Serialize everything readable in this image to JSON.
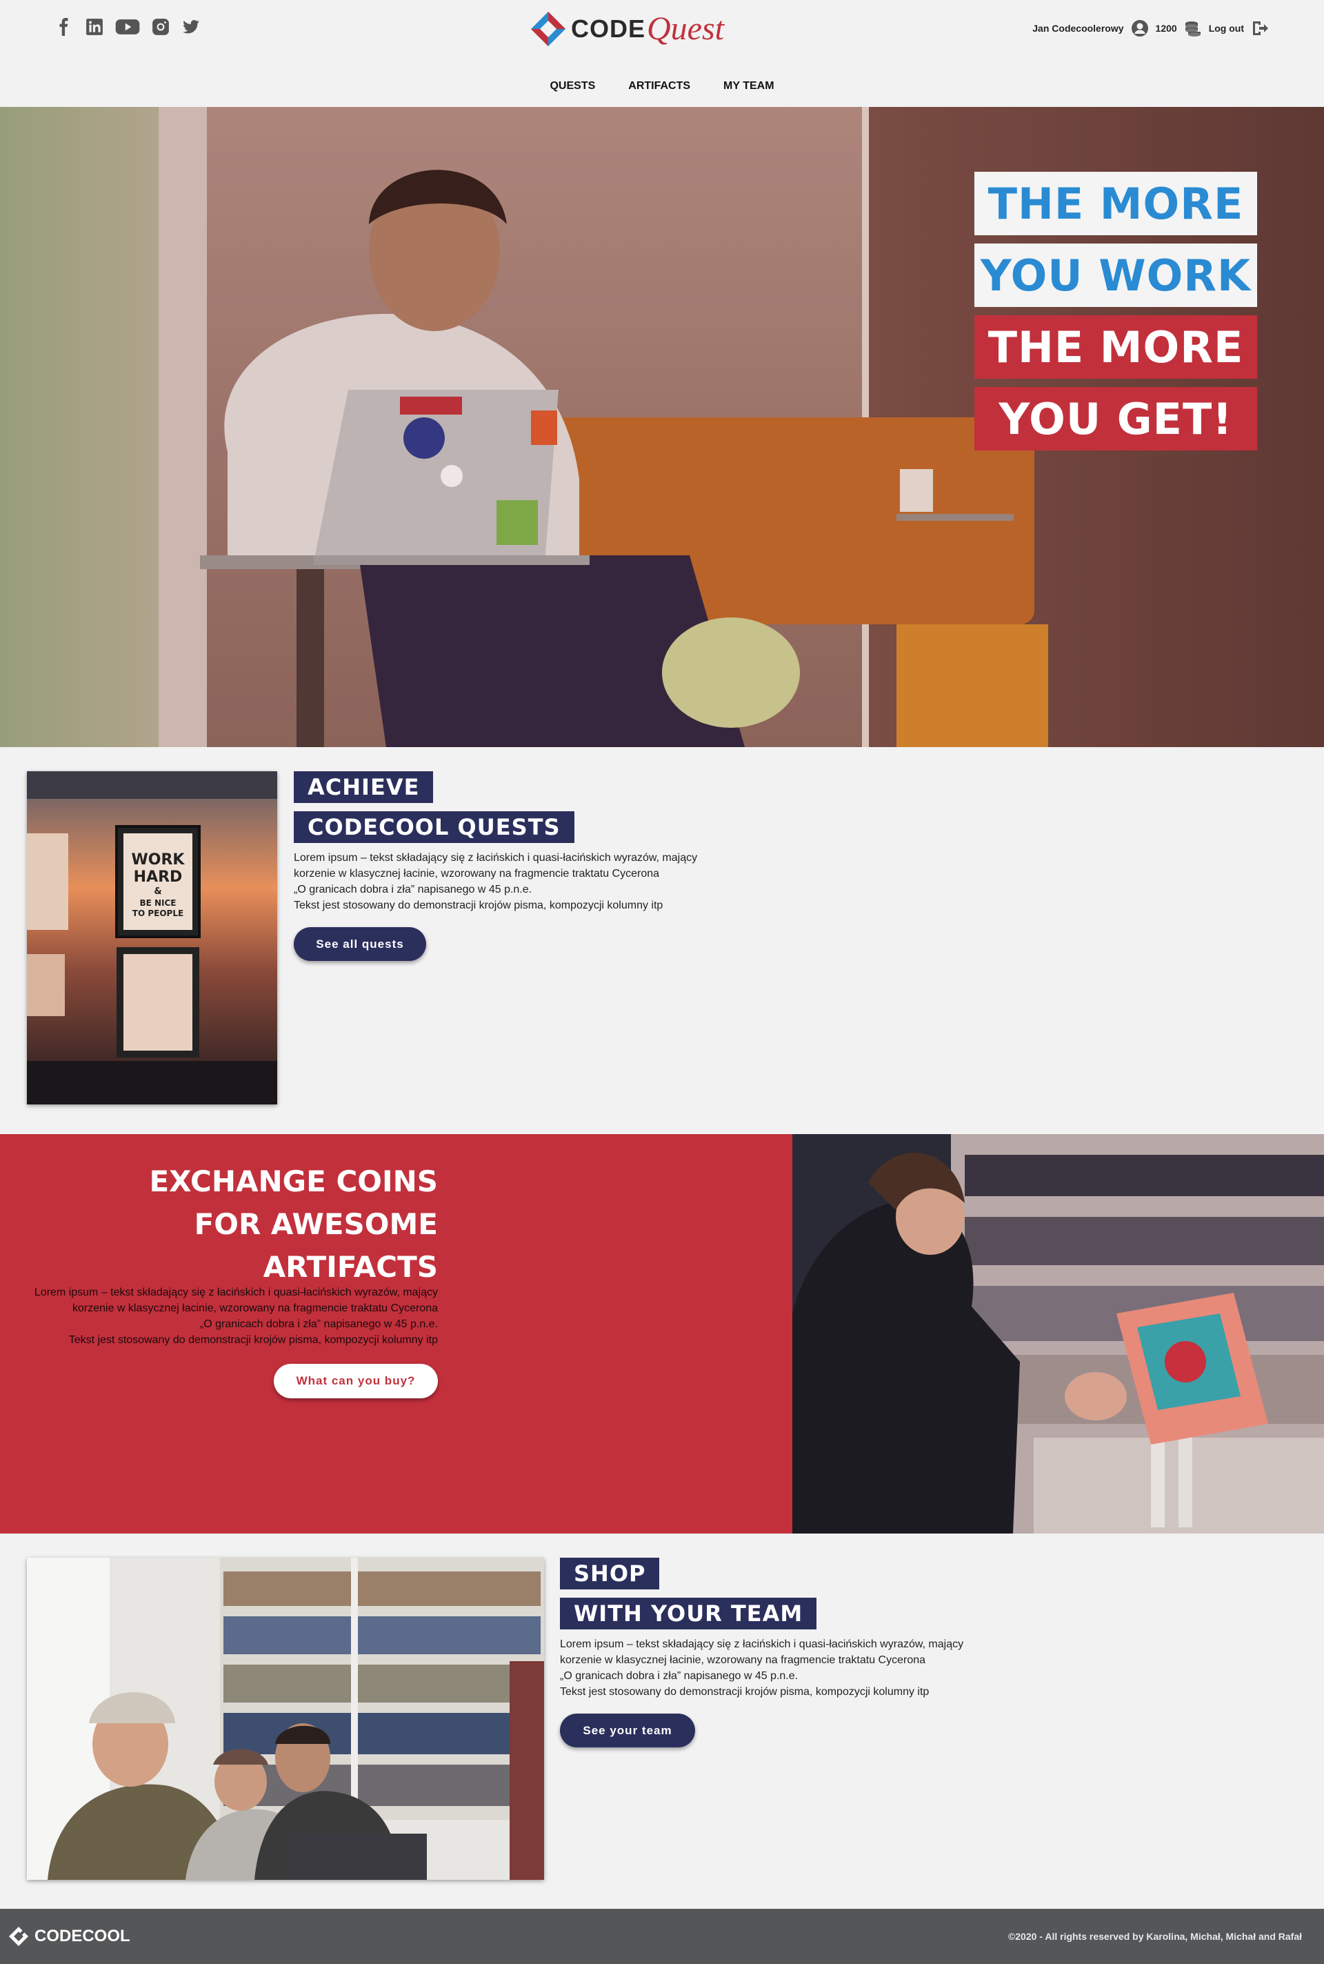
{
  "header": {
    "social_icons": [
      "facebook-icon",
      "linkedin-icon",
      "youtube-icon",
      "instagram-icon",
      "twitter-icon"
    ],
    "logo_code": "CODE",
    "logo_quest": "Quest",
    "user_name": "Jan Codecoolerowy",
    "coins": "1200",
    "logout_label": "Log out"
  },
  "nav": {
    "items": [
      "QUESTS",
      "ARTIFACTS",
      "MY TEAM"
    ]
  },
  "hero": {
    "lines": [
      "THE MORE",
      "YOU WORK",
      "THE MORE",
      "YOU GET!"
    ]
  },
  "quests": {
    "tag1": "ACHIEVE",
    "tag2": "CODECOOL QUESTS",
    "para": [
      "Lorem ipsum – tekst składający się z łacińskich i quasi-łacińskich wyrazów, mający",
      "korzenie w klasycznej łacinie, wzorowany na fragmencie traktatu Cycerona",
      "„O granicach dobra i zła” napisanego w 45 p.n.e.",
      "Tekst jest stosowany do demonstracji krojów pisma, kompozycji kolumny itp"
    ],
    "button": "See all quests",
    "poster_text": [
      "WORK",
      "HARD",
      "&",
      "BE NICE",
      "TO PEOPLE"
    ]
  },
  "coins": {
    "title": [
      "EXCHANGE COINS",
      "FOR AWESOME",
      "ARTIFACTS"
    ],
    "para": [
      "Lorem ipsum – tekst składający się z łacińskich i quasi-łacińskich wyrazów, mający",
      "korzenie w klasycznej łacinie, wzorowany na fragmencie traktatu Cycerona",
      "„O granicach dobra i zła” napisanego w 45 p.n.e.",
      "Tekst jest stosowany do demonstracji krojów pisma, kompozycji kolumny itp"
    ],
    "button": "What can you buy?"
  },
  "team": {
    "tag1": "SHOP",
    "tag2": "WITH YOUR TEAM",
    "para": [
      "Lorem ipsum – tekst składający się z łacińskich i quasi-łacińskich wyrazów, mający",
      "korzenie w klasycznej łacinie, wzorowany na fragmencie traktatu Cycerona",
      "„O granicach dobra i zła” napisanego w 45 p.n.e.",
      "Tekst jest stosowany do demonstracji krojów pisma, kompozycji kolumny itp"
    ],
    "button": "See your team"
  },
  "footer": {
    "brand": "CODECOOL",
    "copyright": "©2020 - All rights reserved by Karolina, Michał, Michał and Rafał"
  },
  "colors": {
    "navy": "#2b2f5c",
    "red": "#c2303c",
    "blue": "#2a8bd3",
    "footer": "#545658"
  }
}
